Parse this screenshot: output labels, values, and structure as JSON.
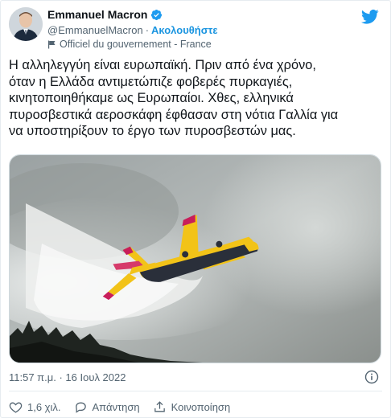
{
  "author": {
    "display_name": "Emmanuel Macron",
    "handle": "@EmmanuelMacron",
    "separator": "·",
    "follow_label": "Ακολουθήστε",
    "label": "Officiel du gouvernement - France"
  },
  "tweet": {
    "text": "Η αλληλεγγύη είναι ευρωπαϊκή. Πριν από ένα χρόνο,\nόταν η Ελλάδα αντιμετώπιζε φοβερές πυρκαγιές,\nκινητοποιηθήκαμε ως Ευρωπαίοι. Χθες, ελληνικά\nπυροσβεστικά αεροσκάφη έφθασαν στη νότια Γαλλία για\nνα υποστηρίξουν το έργο των πυροσβεστών μας.",
    "timestamp": "11:57 π.μ. · 16 Ιουλ 2022"
  },
  "actions": {
    "like_count": "1,6 χιλ.",
    "reply_label": "Απάντηση",
    "share_label": "Κοινοποίηση"
  },
  "colors": {
    "accent": "#1d9bf0",
    "text": "#0f1419",
    "muted": "#536471"
  },
  "icons": {
    "verified": "verified-badge-icon",
    "logo": "twitter-bird-icon",
    "info": "info-icon",
    "like": "heart-icon",
    "reply": "reply-bubble-icon",
    "share": "share-upload-icon",
    "label": "government-flag-icon"
  }
}
